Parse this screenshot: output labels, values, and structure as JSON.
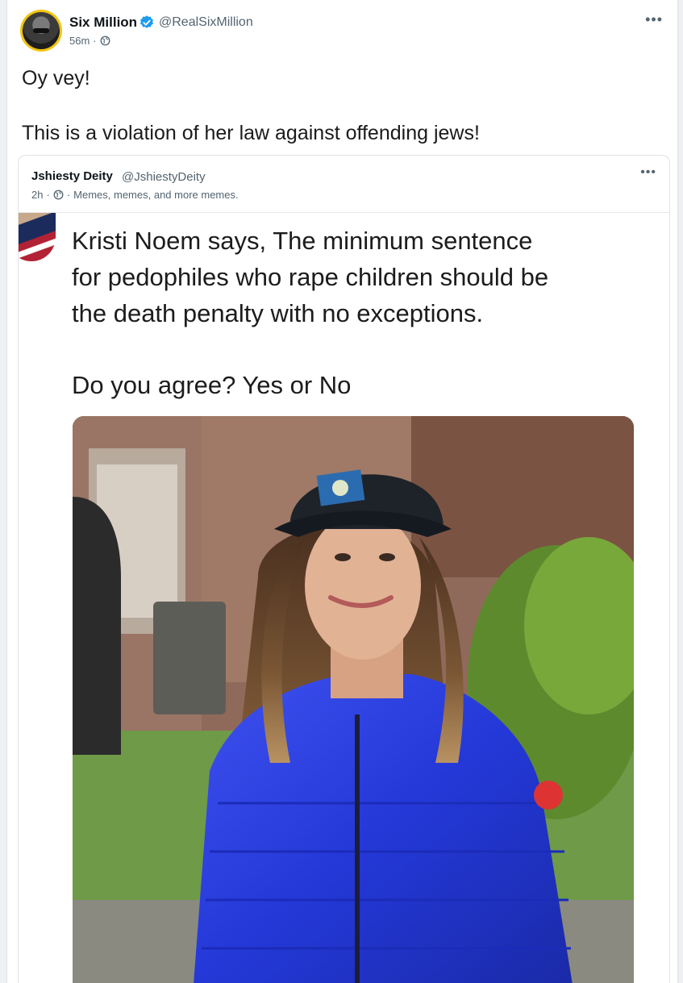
{
  "post": {
    "author_name": "Six Million",
    "author_handle": "@RealSixMillion",
    "timestamp": "56m",
    "visibility_icon": "globe-icon",
    "more_icon": "more-options-icon",
    "text_line1": "Oy vey!",
    "text_line2": "This is a violation of her law against offending jews!"
  },
  "quoted_post": {
    "author_name": "Jshiesty Deity",
    "author_handle": "@JshiestyDeity",
    "timestamp": "2h",
    "group": "Memes, memes, and more memes.",
    "meme": {
      "caption_line1": "Kristi Noem says, The minimum sentence",
      "caption_line2": "for pedophiles who rape children should be",
      "caption_line3": "the death penalty with no exceptions.",
      "caption_line4": "Do you agree? Yes or No"
    }
  },
  "colors": {
    "verified": "#1d9bf0",
    "muted_text": "#536471",
    "jacket_blue": "#2b3de0"
  }
}
